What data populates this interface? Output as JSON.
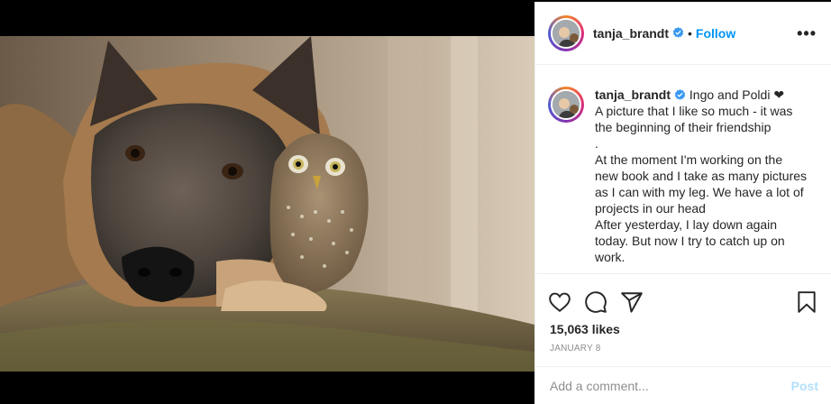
{
  "post": {
    "username": "tanja_brandt",
    "follow_label": "Follow",
    "separator": "•",
    "more_label": "•••"
  },
  "caption": {
    "username": "tanja_brandt",
    "lines": [
      "Ingo and Poldi ❤",
      "A picture that I like so much - it was",
      "the beginning of their friendship",
      ".",
      "At the moment I'm working on the",
      "new book and I take as many pictures",
      "as I can with my leg. We have a lot of",
      "projects in our head",
      "After yesterday, I lay down again",
      "today. But now I try to catch up on",
      "work."
    ]
  },
  "stats": {
    "likes": "15,063 likes",
    "date": "January 8"
  },
  "comment": {
    "placeholder": "Add a comment...",
    "post_label": "Post"
  },
  "icons": {
    "verified": "verified-badge-icon",
    "like": "heart-icon",
    "comment": "comment-bubble-icon",
    "share": "paper-plane-icon",
    "save": "bookmark-icon"
  },
  "colors": {
    "link": "#0095f6",
    "muted": "#8e8e8e",
    "post_disabled": "#b2dffc",
    "verified": "#3897f0"
  }
}
